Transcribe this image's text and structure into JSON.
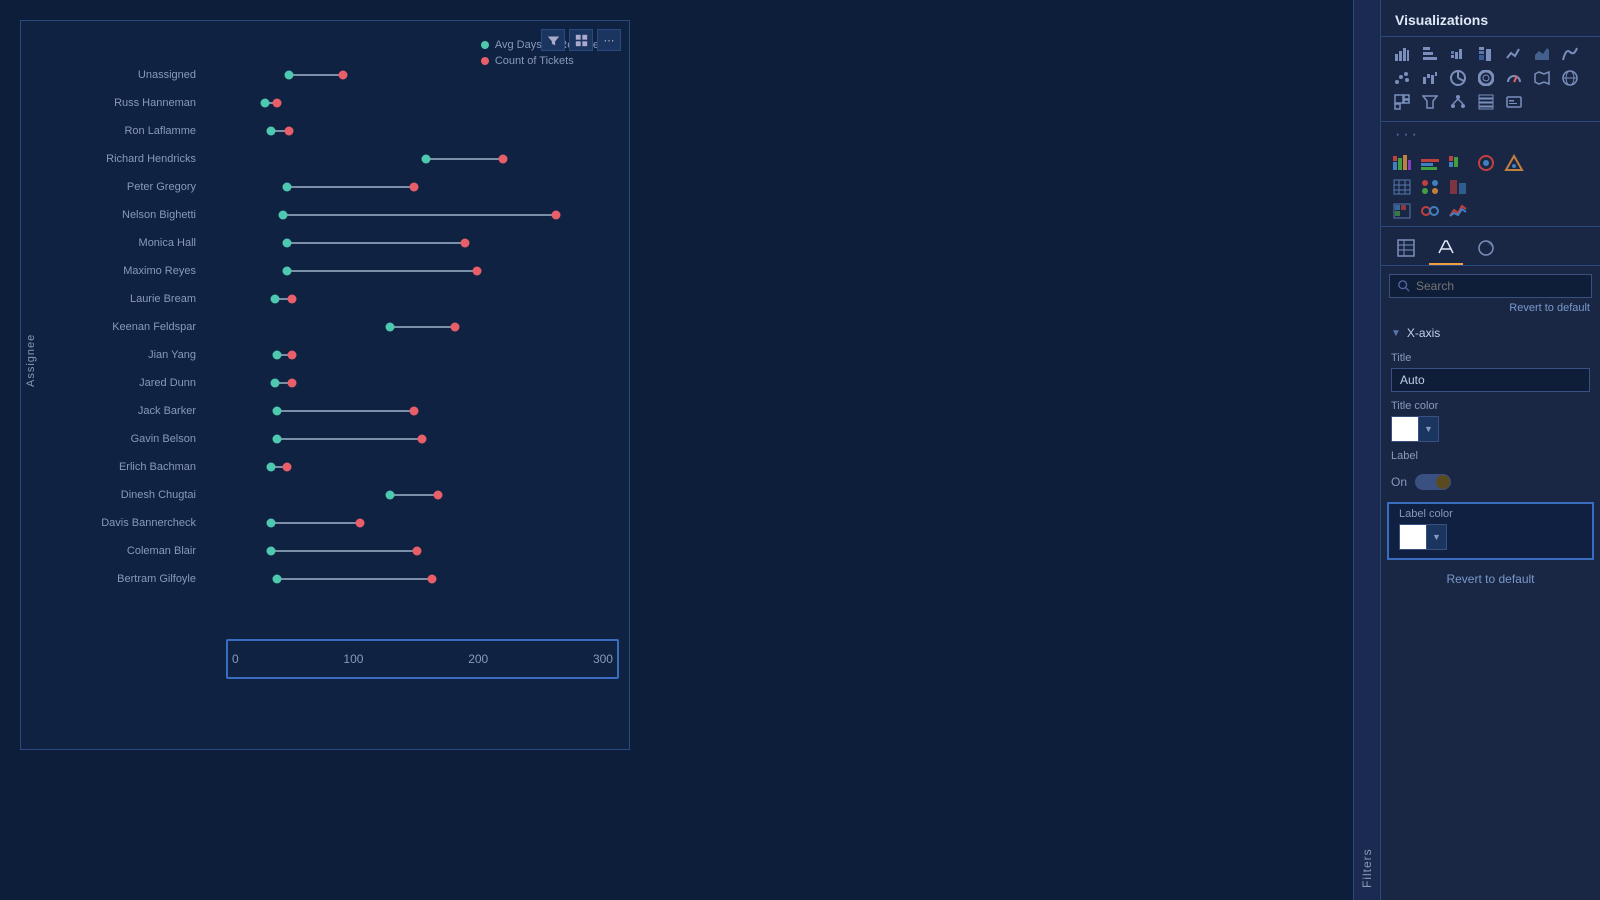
{
  "header": {
    "title": "Visualizations"
  },
  "filters_strip": {
    "label": "Filters"
  },
  "chart": {
    "y_axis_label": "Assignee",
    "legend": [
      {
        "id": "avg_days",
        "label": "Avg Days To Resolve",
        "color": "#4ec9b0"
      },
      {
        "id": "count",
        "label": "Count of Tickets",
        "color": "#e85f6a"
      }
    ],
    "x_ticks": [
      "0",
      "100",
      "200",
      "300"
    ],
    "rows": [
      {
        "name": "Unassigned",
        "teal": 70,
        "red": 115
      },
      {
        "name": "Russ Hanneman",
        "teal": 50,
        "red": 60
      },
      {
        "name": "Ron Laflamme",
        "teal": 55,
        "red": 70
      },
      {
        "name": "Richard Hendricks",
        "teal": 185,
        "red": 250
      },
      {
        "name": "Peter Gregory",
        "teal": 68,
        "red": 175
      },
      {
        "name": "Nelson Bighetti",
        "teal": 65,
        "red": 295
      },
      {
        "name": "Monica Hall",
        "teal": 68,
        "red": 218
      },
      {
        "name": "Maximo Reyes",
        "teal": 68,
        "red": 228
      },
      {
        "name": "Laurie Bream",
        "teal": 58,
        "red": 72
      },
      {
        "name": "Keenan Feldspar",
        "teal": 155,
        "red": 210
      },
      {
        "name": "Jian Yang",
        "teal": 60,
        "red": 72
      },
      {
        "name": "Jared Dunn",
        "teal": 58,
        "red": 72
      },
      {
        "name": "Jack Barker",
        "teal": 60,
        "red": 175
      },
      {
        "name": "Gavin Belson",
        "teal": 60,
        "red": 182
      },
      {
        "name": "Erlich Bachman",
        "teal": 55,
        "red": 68
      },
      {
        "name": "Dinesh Chugtai",
        "teal": 155,
        "red": 195
      },
      {
        "name": "Davis Bannercheck",
        "teal": 55,
        "red": 130
      },
      {
        "name": "Coleman Blair",
        "teal": 55,
        "red": 178
      },
      {
        "name": "Bertram Gilfoyle",
        "teal": 60,
        "red": 190
      }
    ],
    "x_max": 320
  },
  "toolbar": {
    "filter_icon": "▽",
    "grid_icon": "⊞",
    "more_icon": "⋯"
  },
  "right_panel": {
    "search_placeholder": "Search",
    "revert_text": "Revert to default",
    "x_axis_section": "X-axis",
    "title_label": "Title",
    "title_value": "Auto",
    "title_color_label": "Title color",
    "label_text": "Label",
    "label_state": "On",
    "label_color_label": "Label color",
    "revert_default": "Revert to default"
  }
}
